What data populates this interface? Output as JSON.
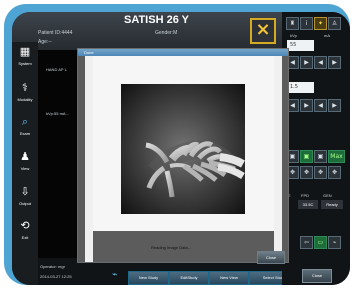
{
  "header": {
    "title": "SATISH 26 Y",
    "patient_id_label": "Patient ID:4444",
    "age_label": "Age:--",
    "gender_label": "Gender:M"
  },
  "sidebar": {
    "items": [
      {
        "label": "System",
        "icon": "system-icon"
      },
      {
        "label": "Modality",
        "icon": "modality-icon"
      },
      {
        "label": "Exam",
        "icon": "exam-icon"
      },
      {
        "label": "View",
        "icon": "view-icon"
      },
      {
        "label": "Output",
        "icon": "output-icon"
      },
      {
        "label": "Exit",
        "icon": "exit-icon"
      }
    ]
  },
  "image_panel": {
    "hand_label": "HAND AP L",
    "kv_label": "kVp:55  mA..."
  },
  "footer": {
    "operator": "Operator: mgr",
    "datetime": "2014-03-27 12:25",
    "buttons": [
      "New Study",
      "EditStudy",
      "New View",
      "Select Study"
    ]
  },
  "right_panel": {
    "fields": {
      "top_value": "55",
      "middle_value": "1.5"
    },
    "labels": {
      "kvp": "kVp",
      "ma": "mA",
      "e": "E",
      "fpd": "FPD",
      "gen": "GEN"
    },
    "values": {
      "fpd": "33.5C",
      "gen": "Ready"
    },
    "close_label": "Close",
    "max_label": "Max"
  },
  "modal": {
    "header_text": "Done",
    "status": "Reading Image Data...",
    "close_label": "Close"
  }
}
